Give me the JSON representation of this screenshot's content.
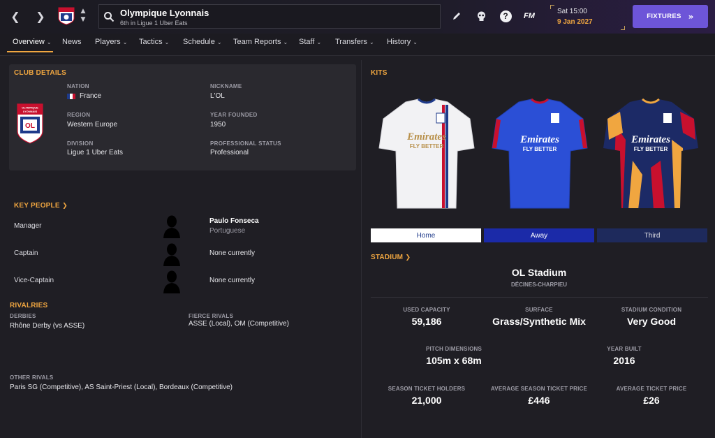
{
  "header": {
    "club_name": "Olympique Lyonnais",
    "club_subtitle": "6th in Ligue 1 Uber Eats",
    "date_line1": "Sat 15:00",
    "date_line2": "9 Jan 2027",
    "fm_label": "FM",
    "fixtures_label": "FIXTURES",
    "help_label": "?"
  },
  "tabs": [
    {
      "label": "Overview",
      "has_menu": true
    },
    {
      "label": "News",
      "has_menu": false
    },
    {
      "label": "Players",
      "has_menu": true
    },
    {
      "label": "Tactics",
      "has_menu": true
    },
    {
      "label": "Schedule",
      "has_menu": true
    },
    {
      "label": "Team Reports",
      "has_menu": true
    },
    {
      "label": "Staff",
      "has_menu": true
    },
    {
      "label": "Transfers",
      "has_menu": true
    },
    {
      "label": "History",
      "has_menu": true
    }
  ],
  "club_details": {
    "title": "CLUB DETAILS",
    "crest_text_top": "OLYMPIQUE LYONNAIS",
    "crest_letters": "OL",
    "nation_label": "NATION",
    "nation_value": "France",
    "region_label": "REGION",
    "region_value": "Western Europe",
    "division_label": "DIVISION",
    "division_value": "Ligue 1 Uber Eats",
    "nickname_label": "NICKNAME",
    "nickname_value": "L'OL",
    "year_founded_label": "YEAR FOUNDED",
    "year_founded_value": "1950",
    "status_label": "PROFESSIONAL STATUS",
    "status_value": "Professional"
  },
  "key_people": {
    "title": "KEY PEOPLE",
    "manager_role": "Manager",
    "manager_name": "Paulo Fonseca",
    "manager_nationality": "Portuguese",
    "captain_role": "Captain",
    "captain_value": "None currently",
    "vice_role": "Vice-Captain",
    "vice_value": "None currently"
  },
  "rivalries": {
    "title": "RIVALRIES",
    "derbies_label": "DERBIES",
    "derbies_value": "Rhône Derby (vs ASSE)",
    "fierce_label": "FIERCE RIVALS",
    "fierce_value": "ASSE (Local), OM (Competitive)",
    "other_label": "OTHER RIVALS",
    "other_value": "Paris SG (Competitive), AS Saint-Priest (Local), Bordeaux (Competitive)"
  },
  "kits": {
    "title": "KITS",
    "sponsor_line1": "Emirates",
    "sponsor_line2": "FLY BETTER",
    "home_label": "Home",
    "away_label": "Away",
    "third_label": "Third",
    "colors": {
      "home": "#f2f2f4",
      "away": "#2b4fd6",
      "third": "#1c2a66",
      "accent_orange": "#f0a640"
    }
  },
  "stadium": {
    "title": "STADIUM",
    "name": "OL Stadium",
    "location": "DÉCINES-CHARPIEU",
    "used_capacity_label": "USED CAPACITY",
    "used_capacity_value": "59,186",
    "surface_label": "SURFACE",
    "surface_value": "Grass/Synthetic Mix",
    "condition_label": "STADIUM CONDITION",
    "condition_value": "Very Good",
    "pitch_label": "PITCH DIMENSIONS",
    "pitch_value": "105m x 68m",
    "year_built_label": "YEAR BUILT",
    "year_built_value": "2016",
    "season_holders_label": "SEASON TICKET HOLDERS",
    "season_holders_value": "21,000",
    "avg_season_price_label": "AVERAGE SEASON TICKET PRICE",
    "avg_season_price_value": "£446",
    "avg_ticket_price_label": "AVERAGE TICKET PRICE",
    "avg_ticket_price_value": "£26"
  }
}
